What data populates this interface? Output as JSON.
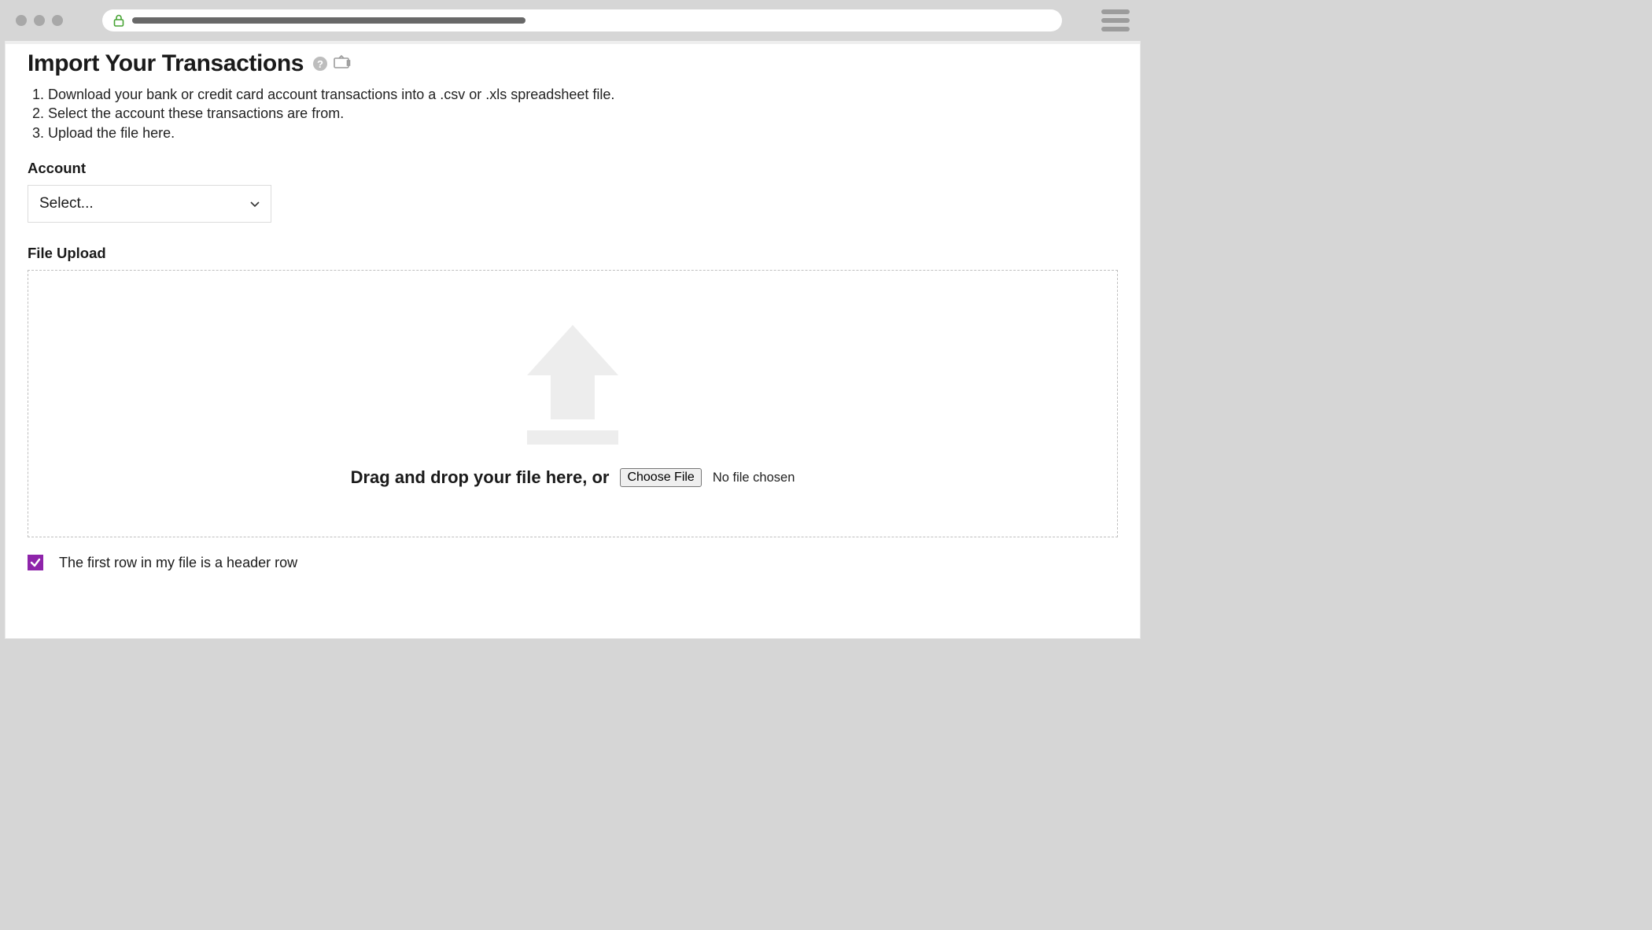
{
  "page": {
    "title": "Import Your Transactions",
    "steps": [
      "Download your bank or credit card account transactions into a .csv or .xls spreadsheet file.",
      "Select the account these transactions are from.",
      "Upload the file here."
    ]
  },
  "account": {
    "label": "Account",
    "placeholder": "Select..."
  },
  "upload": {
    "label": "File Upload",
    "drop_text": "Drag and drop your file here, or",
    "choose_button": "Choose File",
    "no_file_text": "No file chosen"
  },
  "headerRow": {
    "label": "The first row in my file is a header row",
    "checked": true
  },
  "colors": {
    "accent_purple": "#8e24aa",
    "lock_green": "#4caf3a"
  }
}
